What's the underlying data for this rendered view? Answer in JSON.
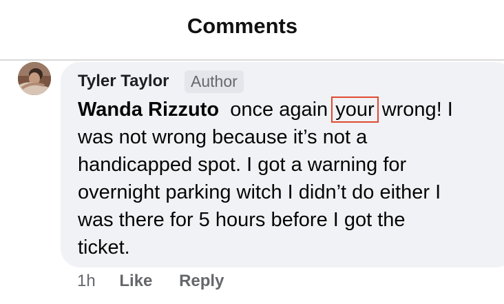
{
  "header": {
    "title": "Comments"
  },
  "comment": {
    "author": "Tyler Taylor",
    "badge": "Author",
    "mention": "Wanda Rizzuto",
    "text_before_highlight": "once again",
    "highlighted_word": "your",
    "line1_rest": "wrong! I",
    "line2": "was not wrong because it’s not a",
    "line3": "handicapped spot. I got a warning for",
    "line4": "overnight parking witch I didn’t do either I",
    "line5": "was there for 5 hours before I got the",
    "line6": "ticket.",
    "timestamp": "1h",
    "like_label": "Like",
    "reply_label": "Reply"
  },
  "colors": {
    "bubble": "#f0f2f5",
    "highlight_box": "#e0482f",
    "secondary_text": "#65676b"
  }
}
